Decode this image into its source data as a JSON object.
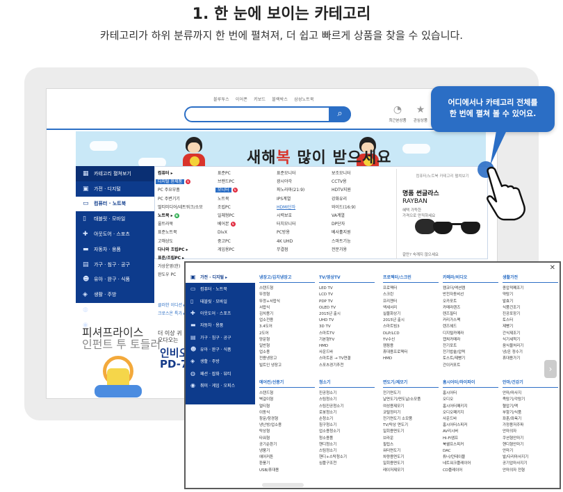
{
  "heading": {
    "title": "1. 한 눈에 보이는 카테고리",
    "subtitle": "카테고리가 하위 분류까지 한 번에 펼쳐져, 더 쉽고 빠르게 상품을 찾을 수 있습니다."
  },
  "header": {
    "top_links": [
      "블루투스",
      "이어폰",
      "키보드",
      "블랙박스",
      "삼성노트북"
    ],
    "search_btn": "⌕",
    "recent_label": "최근본상품",
    "fav_label": "관심상품"
  },
  "banner": {
    "text_pre": "새해",
    "text_fu": "복",
    "text_post": " 많이 받으세요"
  },
  "sidebar": {
    "items": [
      {
        "icon": "▦",
        "label": "카테고리 펼쳐보기"
      },
      {
        "icon": "▣",
        "label": "가전 · 디지털"
      },
      {
        "icon": "▭",
        "label": "컴퓨터 · 노트북"
      },
      {
        "icon": "▯",
        "label": "태블릿 · 모바일"
      },
      {
        "icon": "✚",
        "label": "아웃도어 · 스포츠"
      },
      {
        "icon": "▬",
        "label": "자동차 · 용품"
      },
      {
        "icon": "▤",
        "label": "가구 · 침구 · 공구"
      },
      {
        "icon": "☻",
        "label": "유아 · 완구 · 식품"
      },
      {
        "icon": "◈",
        "label": "생활 · 주방"
      },
      {
        "icon": "◍",
        "label": "패션 · 잡화 · 뷰티"
      },
      {
        "icon": "◉",
        "label": "취미 · 게임 · 오피스"
      }
    ]
  },
  "menu": {
    "col1": [
      "컴퓨터 ▸",
      "디지털 완제품",
      "PC 주요부품",
      "PC 주변기기",
      "멀티미디어/네트워크/소모",
      "노트북 ▸",
      "울트라북",
      "표준노트북",
      "고해상도",
      "다나와 조립PC ▸",
      "표준/조립PC ▸",
      "가상운영(한)",
      "완도우 PC"
    ],
    "col1_links": [
      "클러한 이디션 ▸",
      "크로스온 특가 ▸"
    ],
    "col2": [
      "표준PC",
      "브랜드PC",
      "모니터",
      "노트북",
      "조립PC",
      "일체형PC",
      "베어본",
      "DivX",
      "중고PC",
      "게임용PC"
    ],
    "col3": [
      "표준모니터",
      "광시야각",
      "파노라마(21:9)",
      "IPS계열",
      "HDMI단자",
      "시력보호",
      "터치모니터",
      "PC방용",
      "4K UHD",
      "무결점"
    ],
    "col4": [
      "보조모니터",
      "CCTV용",
      "HDTV지원",
      "강화유리",
      "와이드(16:9)",
      "VA계열",
      "DP단자",
      "베사홀지원",
      "스마트기능",
      "전문가용"
    ]
  },
  "promo": {
    "header": "컴퓨터/노트북 카테고리 펼쳐보기",
    "title": "명품 썬글라스",
    "brand": "RAYBAN",
    "sub1": "혜택 가득한",
    "sub2": "가격으로 만끽하세요",
    "footer": "갈만? 숙깨지 않으세요"
  },
  "lower": {
    "left_t": "더 이상 귀",
    "left_t2": "오다오는 ",
    "ad_a": "피셔프라이스",
    "ad_b": "인펀트 투 토들러",
    "inbi_a": "인비오",
    "inbi_b": "PD-7"
  },
  "callout": {
    "line1": "어디에서나 카테고리 전체를",
    "line2": "한 번에 펼쳐 볼 수 있어요."
  },
  "popup": {
    "sidebar": [
      {
        "icon": "▣",
        "label": "가전 · 디지털 ▸"
      },
      {
        "icon": "▭",
        "label": "컴퓨터 · 노트북"
      },
      {
        "icon": "▯",
        "label": "태블릿 · 모바일"
      },
      {
        "icon": "✚",
        "label": "아웃도어 · 스포츠"
      },
      {
        "icon": "▬",
        "label": "자동차 · 용품"
      },
      {
        "icon": "▤",
        "label": "가구 · 침구 · 공구"
      },
      {
        "icon": "☻",
        "label": "유아 · 완구 · 식품"
      },
      {
        "icon": "◈",
        "label": "생활 · 주방"
      },
      {
        "icon": "◍",
        "label": "패션 · 잡화 · 뷰티"
      },
      {
        "icon": "◉",
        "label": "취미 · 게임 · 오피스"
      }
    ],
    "sections": [
      {
        "title": "냉장고/김치냉장고",
        "items": [
          "스탠드형",
          "뚜껑형",
          "뚜껑+서랍식",
          "서랍식",
          "김치용기",
          "업소전용",
          "3.4도어",
          "2도어",
          "양문형",
          "일반형",
          "업소용",
          "전용냉장고",
          "빌트인 냉장고"
        ]
      },
      {
        "title": "TV/영상TV",
        "items": [
          "LED TV",
          "LCD TV",
          "PDP TV",
          "OLED TV",
          "2015년 출시",
          "UHD TV",
          "3D TV",
          "스마트TV",
          "기본형TV",
          "HMD",
          "사운드바",
          "스마트폰 → TV연결",
          "스포츠경기추천"
        ]
      },
      {
        "title": "프로젝터/스크린",
        "items": [
          "프로젝터",
          "스크린",
          "프리젠터",
          "액세서리",
          "실물화상기",
          "2015년 출시",
          "스마트빔3",
          "DLP/LCD",
          "TV수신",
          "캠핑용",
          "휴대용프로젝터",
          "HMD"
        ]
      },
      {
        "title": "카메라/비디오",
        "items": [
          "캠코더/액션캠",
          "반전자동비선",
          "오카포트",
          "카메라렌즈",
          "렌즈필터",
          "커리가스팩",
          "렌즈헤드",
          "디지털카메라",
          "캡쳐카메라",
          "전기포트",
          "전기밥솥/압력",
          "토스트/제빵기",
          "간이커포트"
        ]
      },
      {
        "title": "생활가전",
        "items": [
          "종압적폐조기",
          "약탕기",
          "발효기",
          "식품건조기",
          "진공포장기",
          "토스터",
          "제빵기",
          "간식제조기",
          "식기세척기",
          "음식물처리기",
          "냉/온 정수기",
          "휴대용가기"
        ]
      },
      {
        "title": "에어컨/선풍기",
        "items": [
          "스탠드형",
          "벽걸이형",
          "멀티형",
          "이동식",
          "창문/창경형",
          "냉난방/업소용",
          "탁상형",
          "타워형",
          "공기순환기",
          "냉풍기",
          "에어커튼",
          "환풍기",
          "USB/휴대용"
        ]
      },
      {
        "title": "청소기",
        "items": [
          "진공청소기",
          "스팀청소기",
          "스팀진공청소기",
          "로봇청소기",
          "손청소기",
          "침구청소기",
          "업소용청소기",
          "청소용품",
          "핸디청소기",
          "스팀정소기",
          "핸디+스탁청소기",
          "심플구조천"
        ]
      },
      {
        "title": "면도기/제모기",
        "items": [
          "전기면도기",
          "날면도기/면도날/소모품",
          "여성용제모기",
          "코털정리기",
          "전기면도기 소모품",
          "TV/탁상 면도기",
          "일회용면도기",
          "브라운",
          "필립스",
          "워터면도기",
          "차량용면도기",
          "일회용면도기",
          "레이저제모기"
        ]
      },
      {
        "title": "홈시어터/하이파이",
        "items": [
          "홈시어터",
          "오디오",
          "홈시어터패키지",
          "오디오패키지",
          "사운드바",
          "홈시어터스피커",
          "AV리시버",
          "Hi-Fi앰프",
          "북쉘프스피커",
          "DAC",
          "튜너/턴테이블",
          "네트워크플레이어",
          "CD플레이어"
        ]
      },
      {
        "title": "안마/건강기",
        "items": [
          "안마/마사지",
          "족탕기/각탕기",
          "혈압기/맥",
          "부항기/식품",
          "좌훈/좌욕기",
          "가정용저주파",
          "안마의자",
          "쿠션형안마기",
          "핸디형안마기",
          "안마기",
          "발/다리마사지기",
          "공기압마사지기",
          "안마의자 전형"
        ]
      }
    ]
  }
}
